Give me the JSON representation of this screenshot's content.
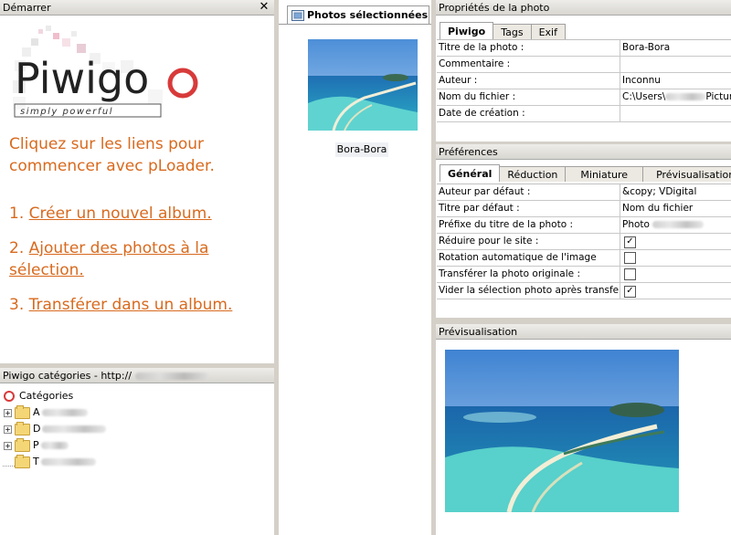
{
  "start_panel": {
    "title": "Démarrer",
    "logo_text": "Piwigo",
    "logo_tagline": "simply powerful",
    "intro": "Cliquez sur les liens pour commencer avec pLoader.",
    "steps": [
      {
        "num": "1.",
        "label": "Créer un nouvel album."
      },
      {
        "num": "2.",
        "label": "Ajouter des photos à la sélection."
      },
      {
        "num": "3.",
        "label": "Transférer dans un album."
      }
    ]
  },
  "categories_panel": {
    "title": "Piwigo catégories - http://",
    "root": "Catégories",
    "items": [
      {
        "initial": "A"
      },
      {
        "initial": "D"
      },
      {
        "initial": "P"
      },
      {
        "initial": "T"
      }
    ]
  },
  "selection_panel": {
    "tab": "Photos sélectionnées",
    "photo_label": "Bora-Bora"
  },
  "properties_panel": {
    "title": "Propriétés de la photo",
    "tabs": [
      "Piwigo",
      "Tags",
      "Exif"
    ],
    "rows": [
      {
        "label": "Titre de la photo :",
        "value": "Bora-Bora"
      },
      {
        "label": "Commentaire :",
        "value": ""
      },
      {
        "label": "Auteur :",
        "value": "Inconnu"
      },
      {
        "label": "Nom du fichier :",
        "value": "C:\\Users\\",
        "value_tail": "Pictures"
      },
      {
        "label": "Date de création :",
        "value": ""
      }
    ]
  },
  "preferences_panel": {
    "title": "Préférences",
    "tabs": [
      "Général",
      "Réduction",
      "Miniature",
      "Prévisualisation"
    ],
    "rows": [
      {
        "label": "Auteur par défaut :",
        "value": "&copy; VDigital"
      },
      {
        "label": "Titre par défaut :",
        "value": "Nom du fichier"
      },
      {
        "label": "Préfixe du titre de la photo :",
        "value": "Photo"
      },
      {
        "label": "Réduire pour le site :",
        "check": "✓"
      },
      {
        "label": "Rotation automatique de l'image",
        "check": ""
      },
      {
        "label": "Transférer la photo originale :",
        "check": ""
      },
      {
        "label": "Vider la sélection photo après transfert :",
        "check": "✓"
      }
    ]
  },
  "preview_panel": {
    "title": "Prévisualisation"
  },
  "colors": {
    "accent": "#d86a1e",
    "background": "#d4d0c8"
  }
}
